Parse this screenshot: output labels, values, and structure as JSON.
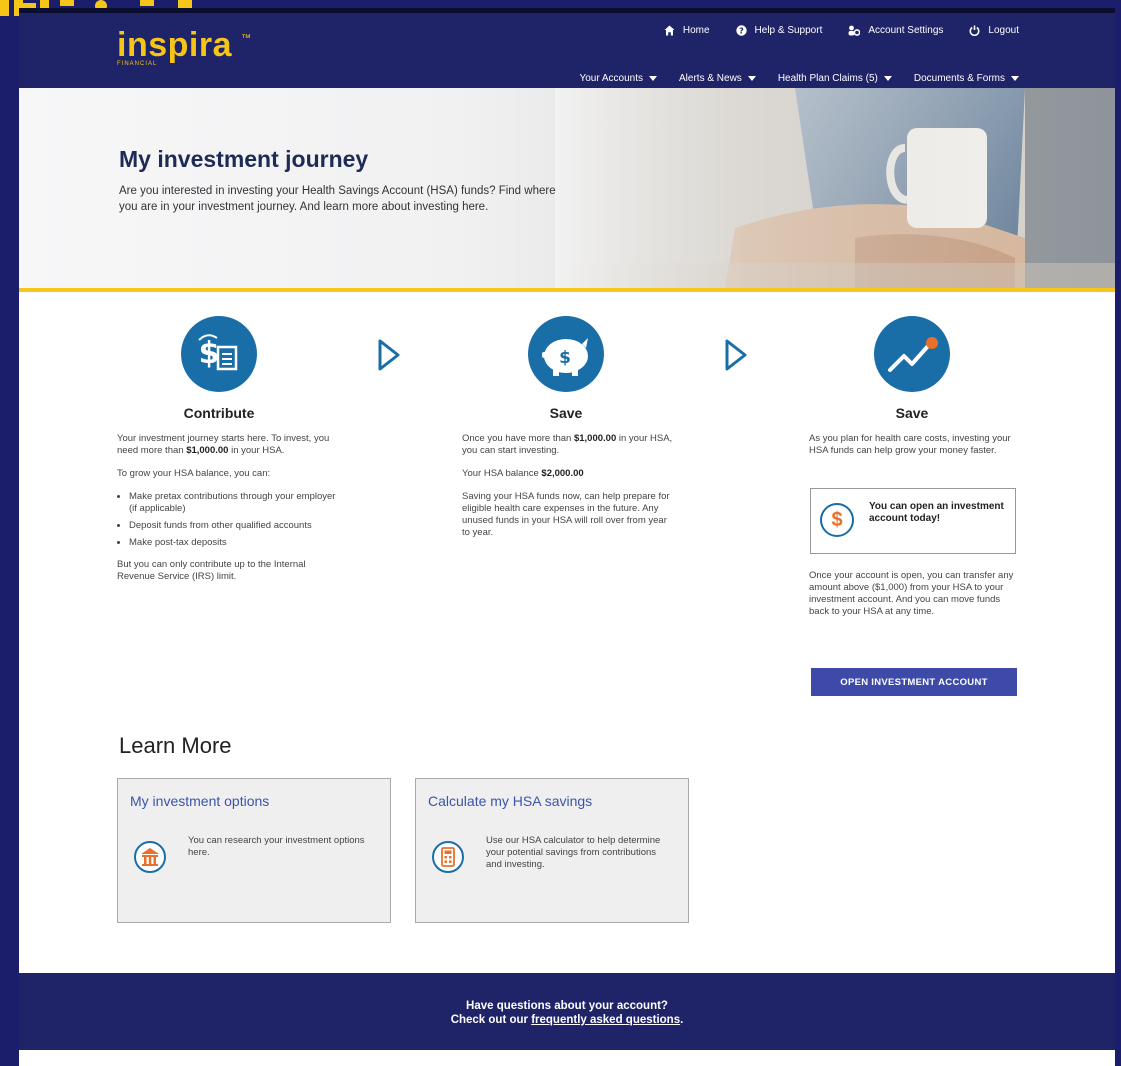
{
  "colors": {
    "navy": "#1f2367",
    "gold": "#f5c518",
    "icon_blue": "#1a6ea8",
    "button": "#3d4aa8",
    "accent_orange": "#e8702a"
  },
  "header": {
    "logo_text": "inspira",
    "logo_subtext": "FINANCIAL",
    "utility_nav": [
      {
        "label": "Home",
        "icon": "home-icon"
      },
      {
        "label": "Help & Support",
        "icon": "help-icon"
      },
      {
        "label": "Account Settings",
        "icon": "settings-icon"
      },
      {
        "label": "Logout",
        "icon": "power-icon"
      }
    ],
    "main_nav": [
      {
        "label": "Your Accounts"
      },
      {
        "label": "Alerts & News"
      },
      {
        "label": "Health Plan Claims (5)"
      },
      {
        "label": "Documents & Forms"
      }
    ]
  },
  "hero": {
    "title": "My investment journey",
    "text": "Are you interested in investing your Health Savings Account (HSA) funds? Find where you are in your investment journey. And learn more about investing here."
  },
  "steps": [
    {
      "title": "Contribute",
      "icon": "dollar-document-icon",
      "intro_a": "Your investment journey starts here. To invest, you need more than ",
      "intro_b": "$1,000.00",
      "intro_c": " in your HSA.",
      "list_intro": "To grow your HSA balance, you can:",
      "bullets": [
        "Make pretax contributions through your employer (if applicable)",
        "Deposit funds from other qualified accounts",
        "Make post-tax deposits"
      ],
      "outro": "But you can only contribute up to the Internal Revenue Service (IRS) limit."
    },
    {
      "title": "Save",
      "icon": "piggy-bank-icon",
      "p1_a": "Once you have more than ",
      "p1_b": "$1,000.00",
      "p1_c": " in your HSA, you can start investing.",
      "p2_a": "Your HSA balance ",
      "p2_b": "$2,000.00",
      "p3": "Saving your HSA funds now, can help prepare for eligible health care expenses in the future. Any unused funds in your HSA will roll over from year to year."
    },
    {
      "title": "Save",
      "icon": "growth-chart-icon",
      "p1": "As you plan for health care costs, investing your HSA funds can help grow your money faster.",
      "callout": "You can open an investment account today!",
      "callout_icon_glyph": "$",
      "p2": "Once your account is open, you can transfer any amount above ($1,000) from your HSA to your investment account. And you can move funds back to your HSA at any time.",
      "button": "OPEN INVESTMENT ACCOUNT"
    }
  ],
  "learn_more": {
    "title": "Learn More",
    "cards": [
      {
        "title": "My investment options",
        "text": "You can research your investment options here.",
        "icon": "bank-building-icon"
      },
      {
        "title": "Calculate my HSA savings",
        "text": "Use our HSA calculator to help determine your potential savings from contributions and investing.",
        "icon": "calculator-icon"
      }
    ]
  },
  "footer": {
    "line1": "Have questions about your account?",
    "line2_prefix": "Check out our ",
    "link": "frequently asked questions",
    "line2_suffix": "."
  }
}
